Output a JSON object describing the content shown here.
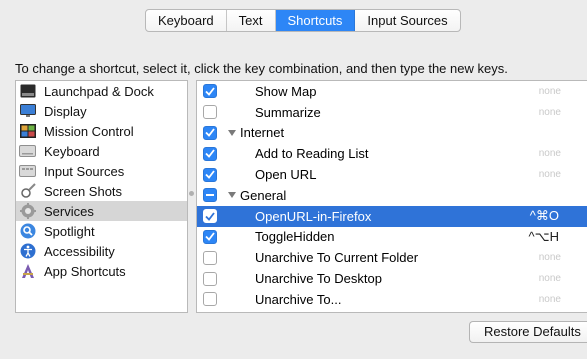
{
  "tabs": [
    {
      "label": "Keyboard",
      "active": false
    },
    {
      "label": "Text",
      "active": false
    },
    {
      "label": "Shortcuts",
      "active": true
    },
    {
      "label": "Input Sources",
      "active": false
    }
  ],
  "instruction": "To change a shortcut, select it, click the key combination, and then type the new keys.",
  "sidebar": {
    "items": [
      {
        "label": "Launchpad & Dock",
        "icon": "launchpad-dock-icon"
      },
      {
        "label": "Display",
        "icon": "display-icon"
      },
      {
        "label": "Mission Control",
        "icon": "mission-control-icon"
      },
      {
        "label": "Keyboard",
        "icon": "keyboard-icon"
      },
      {
        "label": "Input Sources",
        "icon": "input-sources-icon"
      },
      {
        "label": "Screen Shots",
        "icon": "screenshots-icon"
      },
      {
        "label": "Services",
        "icon": "gear-icon",
        "selected": true
      },
      {
        "label": "Spotlight",
        "icon": "spotlight-icon"
      },
      {
        "label": "Accessibility",
        "icon": "accessibility-icon"
      },
      {
        "label": "App Shortcuts",
        "icon": "app-shortcuts-icon"
      }
    ]
  },
  "shortcuts": [
    {
      "label": "Show Map",
      "type": "item",
      "checked": "on",
      "key": "none"
    },
    {
      "label": "Summarize",
      "type": "item",
      "checked": "off",
      "key": "none"
    },
    {
      "label": "Internet",
      "type": "category",
      "checked": "on",
      "key": ""
    },
    {
      "label": "Add to Reading List",
      "type": "item",
      "checked": "on",
      "key": "none"
    },
    {
      "label": "Open URL",
      "type": "item",
      "checked": "on",
      "key": "none"
    },
    {
      "label": "General",
      "type": "category",
      "checked": "mixed",
      "key": ""
    },
    {
      "label": "OpenURL-in-Firefox",
      "type": "item",
      "checked": "on",
      "key": "^⌘O",
      "selected": true
    },
    {
      "label": "ToggleHidden",
      "type": "item",
      "checked": "on",
      "key": "^⌥H"
    },
    {
      "label": "Unarchive To Current Folder",
      "type": "item",
      "checked": "off",
      "key": "none"
    },
    {
      "label": "Unarchive To Desktop",
      "type": "item",
      "checked": "off",
      "key": "none"
    },
    {
      "label": "Unarchive To...",
      "type": "item",
      "checked": "off",
      "key": "none"
    }
  ],
  "restore_label": "Restore Defaults",
  "colors": {
    "accent": "#2d86f6",
    "selection": "#2f73d8",
    "window_bg": "#ececec"
  }
}
